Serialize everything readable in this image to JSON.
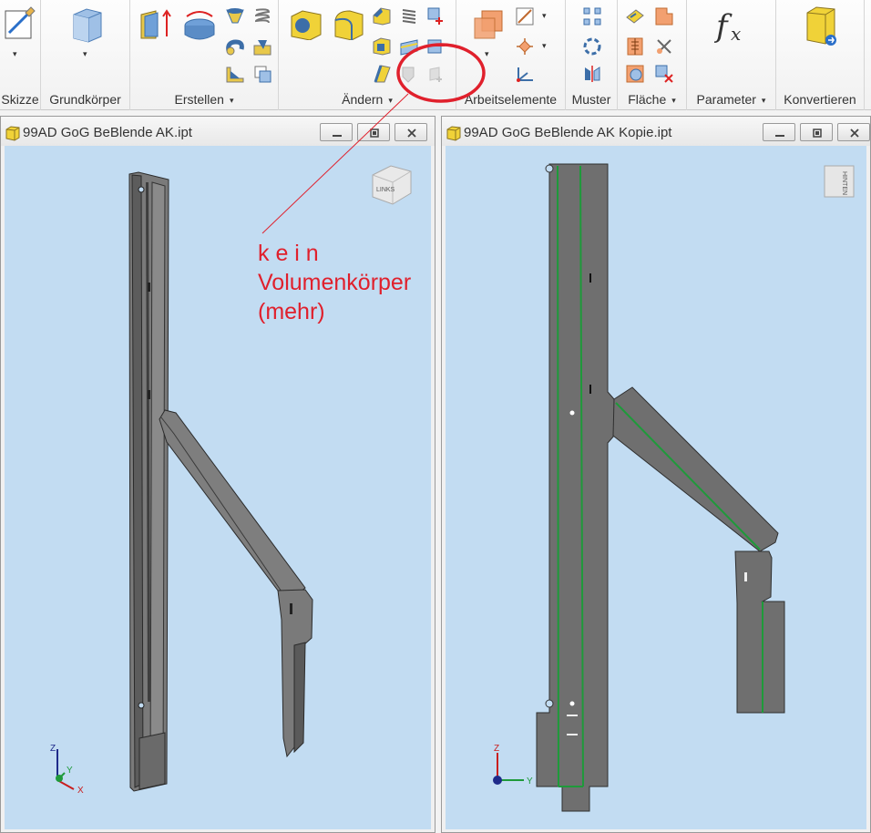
{
  "ribbon": {
    "panels": {
      "skizze": "Skizze",
      "grundkoerper": "Grundkörper",
      "erstellen": "Erstellen",
      "aendern": "Ändern",
      "arbeitselemente": "Arbeitselemente",
      "muster": "Muster",
      "flaeche": "Fläche",
      "parameter": "Parameter",
      "konvertieren": "Konvertieren"
    },
    "dropdown_glyph": "▾"
  },
  "left_window": {
    "title": "99AD GoG BeBlende AK.ipt",
    "viewcube_face": "LINKS",
    "triad": {
      "z": "Z",
      "y": "Y",
      "x": "X"
    }
  },
  "right_window": {
    "title": "99AD GoG BeBlende AK Kopie.ipt",
    "viewcube_face": "HINTEN",
    "triad": {
      "z": "Z",
      "y": "Y"
    }
  },
  "annotation": {
    "text": "k e i n\nVolumenkörper\n(mehr)",
    "color": "#e0202c"
  },
  "colors": {
    "viewport_background": "#c2dcf2",
    "part_gray": "#6f6f6f",
    "bend_line_green": "#1e9a3a"
  }
}
